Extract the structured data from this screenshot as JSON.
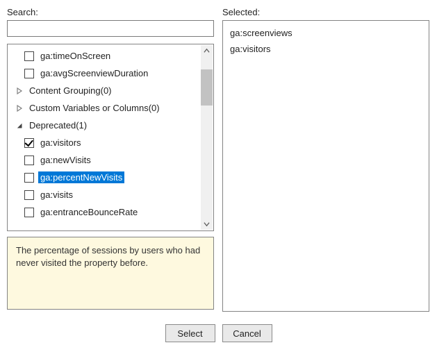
{
  "labels": {
    "search": "Search:",
    "selected": "Selected:"
  },
  "search": {
    "value": "",
    "placeholder": ""
  },
  "tree": {
    "rows": [
      {
        "kind": "item",
        "indent": 1,
        "checked": false,
        "highlight": false,
        "label": "ga:timeOnScreen"
      },
      {
        "kind": "item",
        "indent": 1,
        "checked": false,
        "highlight": false,
        "label": "ga:avgScreenviewDuration"
      },
      {
        "kind": "group",
        "indent": 0,
        "expanded": false,
        "label": "Content Grouping(0)"
      },
      {
        "kind": "group",
        "indent": 0,
        "expanded": false,
        "label": "Custom Variables or Columns(0)"
      },
      {
        "kind": "group",
        "indent": 0,
        "expanded": true,
        "label": "Deprecated(1)"
      },
      {
        "kind": "item",
        "indent": 1,
        "checked": true,
        "highlight": false,
        "label": "ga:visitors"
      },
      {
        "kind": "item",
        "indent": 1,
        "checked": false,
        "highlight": false,
        "label": "ga:newVisits"
      },
      {
        "kind": "item",
        "indent": 1,
        "checked": false,
        "highlight": true,
        "label": "ga:percentNewVisits"
      },
      {
        "kind": "item",
        "indent": 1,
        "checked": false,
        "highlight": false,
        "label": "ga:visits"
      },
      {
        "kind": "item",
        "indent": 1,
        "checked": false,
        "highlight": false,
        "label": "ga:entranceBounceRate"
      }
    ]
  },
  "description": "The percentage of sessions by users who had never visited the property before.",
  "selected_items": [
    "ga:screenviews",
    "ga:visitors"
  ],
  "buttons": {
    "select": "Select",
    "cancel": "Cancel"
  }
}
